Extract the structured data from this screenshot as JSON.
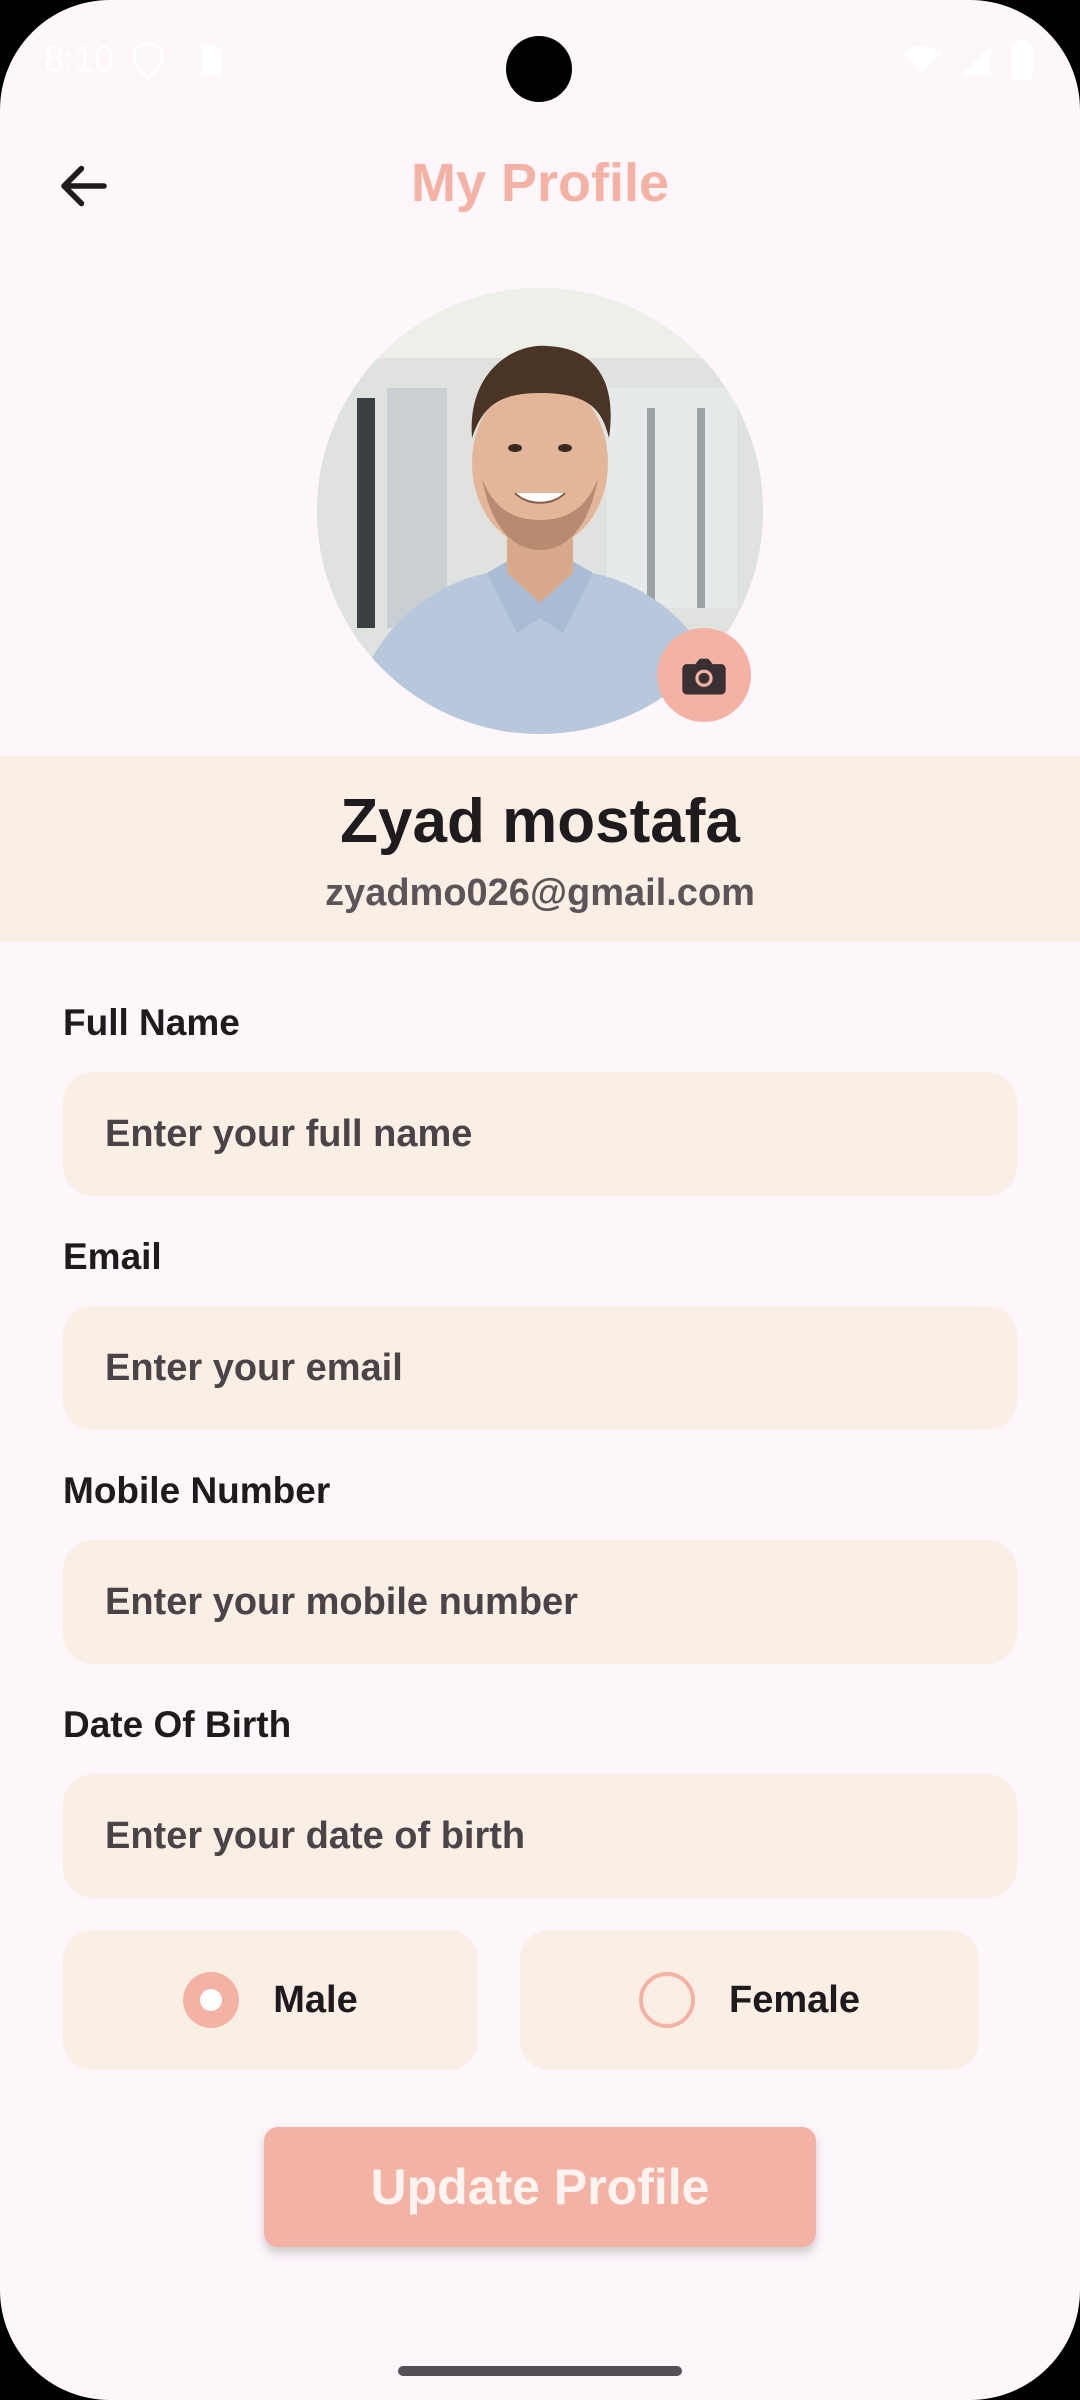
{
  "status_bar": {
    "time": "8:10"
  },
  "app_bar": {
    "title": "My Profile"
  },
  "profile": {
    "name": "Zyad mostafa",
    "email": "zyadmo026@gmail.com"
  },
  "form": {
    "full_name": {
      "label": "Full Name",
      "placeholder": "Enter your full name",
      "value": ""
    },
    "email": {
      "label": "Email",
      "placeholder": "Enter your email",
      "value": ""
    },
    "mobile": {
      "label": "Mobile Number",
      "placeholder": "Enter your mobile number",
      "value": ""
    },
    "dob": {
      "label": "Date Of Birth",
      "placeholder": "Enter your date of birth",
      "value": ""
    }
  },
  "gender": {
    "male_label": "Male",
    "female_label": "Female",
    "selected": "Male"
  },
  "actions": {
    "update_label": "Update Profile"
  },
  "colors": {
    "accent": "#F4B2A4",
    "field_bg": "#FAEFE4",
    "page_bg": "#FDF6FB"
  },
  "icons": {
    "back": "arrow-back-icon",
    "camera": "camera-icon",
    "wifi": "wifi-icon",
    "signal": "signal-icon",
    "battery": "battery-icon"
  }
}
